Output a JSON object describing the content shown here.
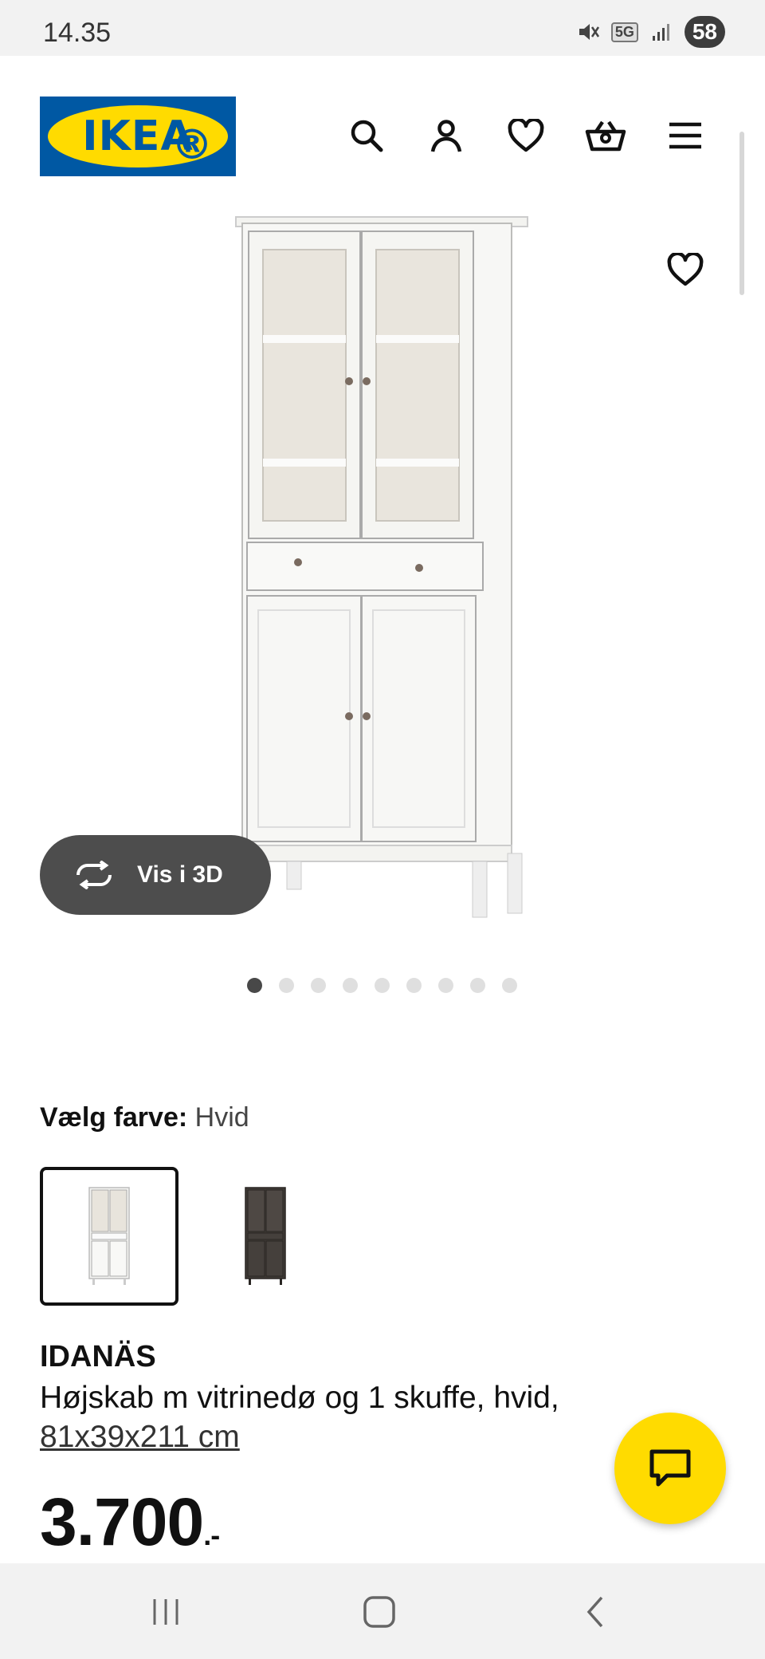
{
  "status_bar": {
    "time": "14.35",
    "network": "5G",
    "battery": "58"
  },
  "header": {
    "logo_text": "IKEA",
    "icons": [
      "search-icon",
      "profile-icon",
      "heart-icon",
      "basket-icon",
      "menu-icon"
    ]
  },
  "gallery": {
    "vis_3d_label": "Vis i 3D",
    "image_count": 9,
    "active_index": 0
  },
  "color": {
    "label": "Vælg farve:",
    "value": "Hvid",
    "options": [
      "white",
      "dark-brown"
    ]
  },
  "product": {
    "brand": "IDANÄS",
    "description": "Højskab m vitrinedø og 1 skuffe, hvid,",
    "dimensions": "81x39x211 cm",
    "price": "3.700",
    "price_suffix": ".-"
  },
  "colors": {
    "brand_blue": "#0058a3",
    "brand_yellow": "#ffdb00",
    "pill_dark": "#4d4d4d"
  }
}
